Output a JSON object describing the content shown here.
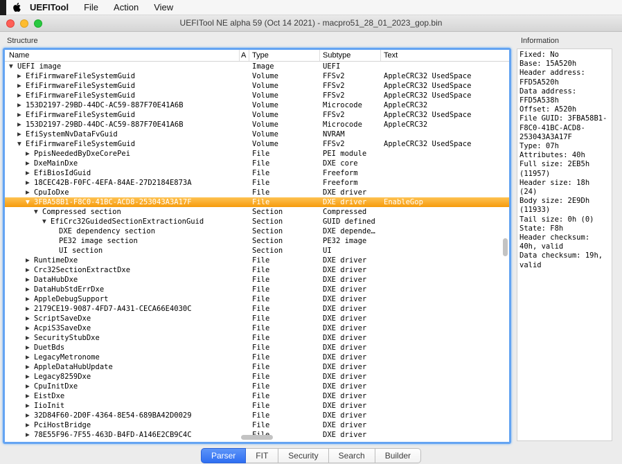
{
  "menubar": {
    "app_name": "UEFITool",
    "items": [
      "File",
      "Action",
      "View"
    ]
  },
  "window": {
    "title": "UEFITool NE alpha 59 (Oct 14 2021) - macpro51_28_01_2023_gop.bin"
  },
  "panels": {
    "structure_label": "Structure",
    "information_label": "Information"
  },
  "icons": {
    "expanded": "▼",
    "collapsed": "▶"
  },
  "tree": {
    "columns": [
      "Name",
      "A",
      "Type",
      "Subtype",
      "Text"
    ],
    "rows": [
      {
        "level": 0,
        "arrow": "down",
        "name": "UEFI image",
        "type": "Image",
        "subtype": "UEFI",
        "text": "",
        "selected": false
      },
      {
        "level": 1,
        "arrow": "right",
        "name": "EfiFirmwareFileSystemGuid",
        "type": "Volume",
        "subtype": "FFSv2",
        "text": "AppleCRC32 UsedSpace",
        "selected": false
      },
      {
        "level": 1,
        "arrow": "right",
        "name": "EfiFirmwareFileSystemGuid",
        "type": "Volume",
        "subtype": "FFSv2",
        "text": "AppleCRC32 UsedSpace",
        "selected": false
      },
      {
        "level": 1,
        "arrow": "right",
        "name": "EfiFirmwareFileSystemGuid",
        "type": "Volume",
        "subtype": "FFSv2",
        "text": "AppleCRC32 UsedSpace",
        "selected": false
      },
      {
        "level": 1,
        "arrow": "right",
        "name": "153D2197-29BD-44DC-AC59-887F70E41A6B",
        "type": "Volume",
        "subtype": "Microcode",
        "text": "AppleCRC32",
        "selected": false
      },
      {
        "level": 1,
        "arrow": "right",
        "name": "EfiFirmwareFileSystemGuid",
        "type": "Volume",
        "subtype": "FFSv2",
        "text": "AppleCRC32 UsedSpace",
        "selected": false
      },
      {
        "level": 1,
        "arrow": "right",
        "name": "153D2197-29BD-44DC-AC59-887F70E41A6B",
        "type": "Volume",
        "subtype": "Microcode",
        "text": "AppleCRC32",
        "selected": false
      },
      {
        "level": 1,
        "arrow": "right",
        "name": "EfiSystemNvDataFvGuid",
        "type": "Volume",
        "subtype": "NVRAM",
        "text": "",
        "selected": false
      },
      {
        "level": 1,
        "arrow": "down",
        "name": "EfiFirmwareFileSystemGuid",
        "type": "Volume",
        "subtype": "FFSv2",
        "text": "AppleCRC32 UsedSpace",
        "selected": false
      },
      {
        "level": 2,
        "arrow": "right",
        "name": "PpisNeededByDxeCorePei",
        "type": "File",
        "subtype": "PEI module",
        "text": "",
        "selected": false
      },
      {
        "level": 2,
        "arrow": "right",
        "name": "DxeMainDxe",
        "type": "File",
        "subtype": "DXE core",
        "text": "",
        "selected": false
      },
      {
        "level": 2,
        "arrow": "right",
        "name": "EfiBiosIdGuid",
        "type": "File",
        "subtype": "Freeform",
        "text": "",
        "selected": false
      },
      {
        "level": 2,
        "arrow": "right",
        "name": "18CEC42B-F0FC-4EFA-84AE-27D2184E873A",
        "type": "File",
        "subtype": "Freeform",
        "text": "",
        "selected": false
      },
      {
        "level": 2,
        "arrow": "right",
        "name": "CpuIoDxe",
        "type": "File",
        "subtype": "DXE driver",
        "text": "",
        "selected": false
      },
      {
        "level": 2,
        "arrow": "down",
        "name": "3FBA58B1-F8C0-41BC-ACD8-253043A3A17F",
        "type": "File",
        "subtype": "DXE driver",
        "text": "EnableGop",
        "selected": true
      },
      {
        "level": 3,
        "arrow": "down",
        "name": "Compressed section",
        "type": "Section",
        "subtype": "Compressed",
        "text": "",
        "selected": false
      },
      {
        "level": 4,
        "arrow": "down",
        "name": "EfiCrc32GuidedSectionExtractionGuid",
        "type": "Section",
        "subtype": "GUID defined",
        "text": "",
        "selected": false
      },
      {
        "level": 5,
        "arrow": "none",
        "name": "DXE dependency section",
        "type": "Section",
        "subtype": "DXE depende…",
        "text": "",
        "selected": false
      },
      {
        "level": 5,
        "arrow": "none",
        "name": "PE32 image section",
        "type": "Section",
        "subtype": "PE32 image",
        "text": "",
        "selected": false
      },
      {
        "level": 5,
        "arrow": "none",
        "name": "UI section",
        "type": "Section",
        "subtype": "UI",
        "text": "",
        "selected": false
      },
      {
        "level": 2,
        "arrow": "right",
        "name": "RuntimeDxe",
        "type": "File",
        "subtype": "DXE driver",
        "text": "",
        "selected": false
      },
      {
        "level": 2,
        "arrow": "right",
        "name": "Crc32SectionExtractDxe",
        "type": "File",
        "subtype": "DXE driver",
        "text": "",
        "selected": false
      },
      {
        "level": 2,
        "arrow": "right",
        "name": "DataHubDxe",
        "type": "File",
        "subtype": "DXE driver",
        "text": "",
        "selected": false
      },
      {
        "level": 2,
        "arrow": "right",
        "name": "DataHubStdErrDxe",
        "type": "File",
        "subtype": "DXE driver",
        "text": "",
        "selected": false
      },
      {
        "level": 2,
        "arrow": "right",
        "name": "AppleDebugSupport",
        "type": "File",
        "subtype": "DXE driver",
        "text": "",
        "selected": false
      },
      {
        "level": 2,
        "arrow": "right",
        "name": "2179CE19-9087-4FD7-A431-CECA66E4030C",
        "type": "File",
        "subtype": "DXE driver",
        "text": "",
        "selected": false
      },
      {
        "level": 2,
        "arrow": "right",
        "name": "ScriptSaveDxe",
        "type": "File",
        "subtype": "DXE driver",
        "text": "",
        "selected": false
      },
      {
        "level": 2,
        "arrow": "right",
        "name": "AcpiS3SaveDxe",
        "type": "File",
        "subtype": "DXE driver",
        "text": "",
        "selected": false
      },
      {
        "level": 2,
        "arrow": "right",
        "name": "SecurityStubDxe",
        "type": "File",
        "subtype": "DXE driver",
        "text": "",
        "selected": false
      },
      {
        "level": 2,
        "arrow": "right",
        "name": "DuetBds",
        "type": "File",
        "subtype": "DXE driver",
        "text": "",
        "selected": false
      },
      {
        "level": 2,
        "arrow": "right",
        "name": "LegacyMetronome",
        "type": "File",
        "subtype": "DXE driver",
        "text": "",
        "selected": false
      },
      {
        "level": 2,
        "arrow": "right",
        "name": "AppleDataHubUpdate",
        "type": "File",
        "subtype": "DXE driver",
        "text": "",
        "selected": false
      },
      {
        "level": 2,
        "arrow": "right",
        "name": "Legacy8259Dxe",
        "type": "File",
        "subtype": "DXE driver",
        "text": "",
        "selected": false
      },
      {
        "level": 2,
        "arrow": "right",
        "name": "CpuInitDxe",
        "type": "File",
        "subtype": "DXE driver",
        "text": "",
        "selected": false
      },
      {
        "level": 2,
        "arrow": "right",
        "name": "EistDxe",
        "type": "File",
        "subtype": "DXE driver",
        "text": "",
        "selected": false
      },
      {
        "level": 2,
        "arrow": "right",
        "name": "IioInit",
        "type": "File",
        "subtype": "DXE driver",
        "text": "",
        "selected": false
      },
      {
        "level": 2,
        "arrow": "right",
        "name": "32D84F60-2D0F-4364-8E54-689BA42D0029",
        "type": "File",
        "subtype": "DXE driver",
        "text": "",
        "selected": false
      },
      {
        "level": 2,
        "arrow": "right",
        "name": "PciHostBridge",
        "type": "File",
        "subtype": "DXE driver",
        "text": "",
        "selected": false
      },
      {
        "level": 2,
        "arrow": "right",
        "name": "78E55F96-7F55-463D-B4FD-A146E2CB9C4C",
        "type": "File",
        "subtype": "DXE driver",
        "text": "",
        "selected": false
      }
    ]
  },
  "information": {
    "lines": [
      "Fixed: No",
      "Base: 15A520h",
      "Header address: FFD5A520h",
      "Data address: FFD5A538h",
      "Offset: A520h",
      "File GUID: 3FBA58B1-F8C0-41BC-ACD8-253043A3A17F",
      "Type: 07h",
      "Attributes: 40h",
      "Full size: 2EB5h (11957)",
      "Header size: 18h (24)",
      "Body size: 2E9Dh (11933)",
      "Tail size: 0h (0)",
      "State: F8h",
      "Header checksum: 40h, valid",
      "Data checksum: 19h, valid"
    ]
  },
  "tabs": {
    "items": [
      "Parser",
      "FIT",
      "Security",
      "Search",
      "Builder"
    ],
    "selected": "Parser"
  },
  "colors": {
    "selection_orange": "#f69b0d",
    "tab_selected_blue": "#2e6ef2",
    "focus_ring_blue": "#64a4f2"
  }
}
